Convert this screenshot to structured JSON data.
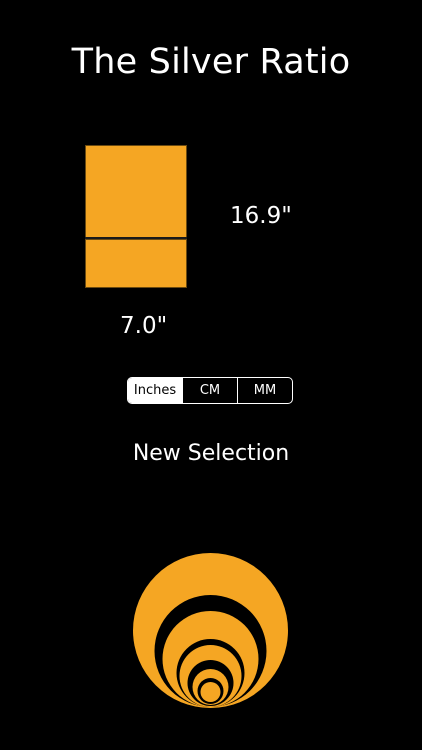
{
  "header": {
    "title": "The Silver Ratio"
  },
  "diagram": {
    "height_label": "16.9\"",
    "width_label": "7.0\"",
    "fill_color": "#F5A623"
  },
  "units": {
    "options": [
      "Inches",
      "CM",
      "MM"
    ],
    "selected": "Inches"
  },
  "actions": {
    "new_selection": "New Selection"
  },
  "logo": {
    "icon": "nested-circles-logo",
    "color": "#F5A623"
  }
}
